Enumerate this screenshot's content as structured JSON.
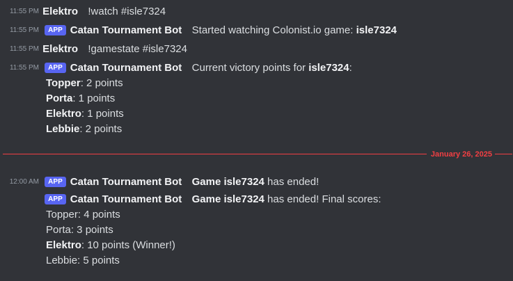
{
  "messages": {
    "m1": {
      "time": "11:55 PM",
      "author": "Elektro",
      "text": "!watch #isle7324"
    },
    "m2": {
      "time": "11:55 PM",
      "badge": "APP",
      "author": "Catan Tournament Bot",
      "text": "Started watching Colonist.io game: ",
      "bold": "isle7324"
    },
    "m3": {
      "time": "11:55 PM",
      "author": "Elektro",
      "text": "!gamestate #isle7324"
    },
    "m4": {
      "time": "11:55 PM",
      "badge": "APP",
      "author": "Catan Tournament Bot",
      "text": "Current victory points for ",
      "bold": "isle7324",
      "after": ":",
      "lines": [
        {
          "name": "Topper",
          "value": ": 2 points"
        },
        {
          "name": "Porta",
          "value": ": 1 points"
        },
        {
          "name": "Elektro",
          "value": ": 1 points"
        },
        {
          "name": "Lebbie",
          "value": ": 2 points"
        }
      ]
    }
  },
  "divider": {
    "date": "January 26, 2025"
  },
  "later": {
    "m5": {
      "time": "12:00 AM",
      "badge": "APP",
      "author": "Catan Tournament Bot",
      "bold": "Game isle7324",
      "text": " has ended!"
    },
    "m6": {
      "badge": "APP",
      "author": "Catan Tournament Bot",
      "bold": "Game isle7324",
      "text": " has ended! Final scores:",
      "lines": [
        {
          "text": "Topper: 4 points"
        },
        {
          "text": "Porta: 3 points"
        },
        {
          "name": "Elektro",
          "value": ": 10 points (Winner!)"
        },
        {
          "text": "Lebbie: 5 points"
        }
      ]
    }
  },
  "colors": {
    "background": "#313338",
    "accent": "#5865f2",
    "divider": "#f23f43"
  }
}
